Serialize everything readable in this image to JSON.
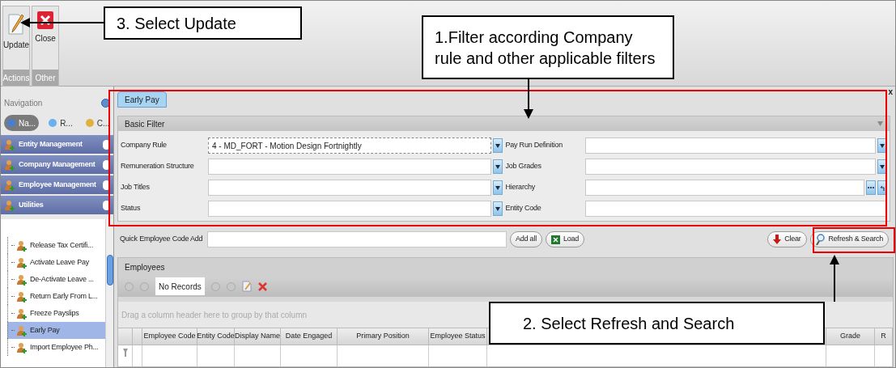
{
  "ribbon": {
    "buttons": [
      {
        "label": "Update",
        "kind": "edit"
      },
      {
        "label": "Close",
        "kind": "close"
      }
    ],
    "groups": [
      "Actions",
      "Other"
    ]
  },
  "navigation": {
    "title": "Navigation",
    "tabs": [
      {
        "label": "Na...",
        "selected": true
      },
      {
        "label": "R...",
        "selected": false
      },
      {
        "label": "C...",
        "selected": false
      }
    ],
    "groups": [
      "Entity Management",
      "Company Management",
      "Employee Management",
      "Utilities"
    ],
    "tree_items": [
      {
        "label": "Release Tax Certifi...",
        "selected": false
      },
      {
        "label": "Activate Leave Pay",
        "selected": false
      },
      {
        "label": "De-Activate Leave ...",
        "selected": false
      },
      {
        "label": "Return Early From L...",
        "selected": false
      },
      {
        "label": "Freeze Payslips",
        "selected": false
      },
      {
        "label": "Early Pay",
        "selected": true
      },
      {
        "label": "Import Employee Ph...",
        "selected": false
      }
    ]
  },
  "document_tab": {
    "label": "Early Pay",
    "selected": true,
    "close_glyph": "x"
  },
  "basic_filter": {
    "title": "Basic Filter",
    "left_fields": [
      {
        "label": "Company Rule",
        "value": "4 - MD_FORT - Motion Design Fortnightly",
        "kind": "dropdown"
      },
      {
        "label": "Remuneration Structure",
        "kind": "dropdown"
      },
      {
        "label": "Job Titles",
        "kind": "dropdown"
      },
      {
        "label": "Status",
        "kind": "dropdown"
      }
    ],
    "right_fields": [
      {
        "label": "Pay Run Definition",
        "kind": "dropdown"
      },
      {
        "label": "Job Grades",
        "kind": "dropdown"
      },
      {
        "label": "Hierarchy",
        "kind": "picker"
      },
      {
        "label": "Entity Code",
        "kind": "text"
      }
    ]
  },
  "quick_add": {
    "label": "Quick Employee Code Add",
    "buttons": [
      {
        "label": "Add all",
        "kind": "plain"
      },
      {
        "label": "Load",
        "kind": "excel"
      }
    ]
  },
  "actions": [
    {
      "label": "Clear",
      "kind": "clear"
    },
    {
      "label": "Refresh & Search",
      "kind": "search"
    }
  ],
  "employees": {
    "title": "Employees",
    "pager": "No Records",
    "group_hint": "Drag a column header here to group by that column",
    "columns": [
      "Employee Code",
      "Entity Code",
      "Display Name",
      "Date Engaged",
      "Primary Position",
      "Employee Status",
      "Grade",
      "R"
    ]
  },
  "annotations": [
    {
      "text": "3. Select Update"
    },
    {
      "text": "1.Filter according Company rule and other applicable filters"
    },
    {
      "text": "2. Select Refresh and Search"
    }
  ]
}
